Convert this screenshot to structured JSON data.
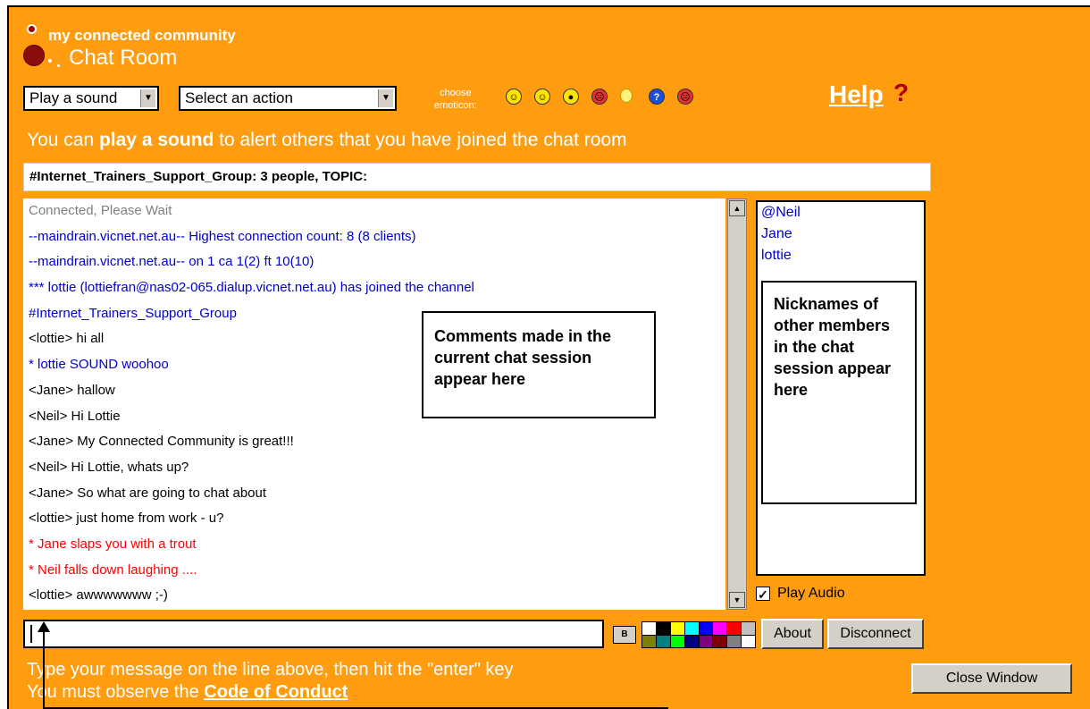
{
  "header": {
    "brand": "my connected community",
    "title": "Chat Room"
  },
  "controls": {
    "sound_select": "Play a sound",
    "action_select": "Select an action",
    "emoticon_label_1": "choose",
    "emoticon_label_2": "emoticon:",
    "emoticons": [
      "smile-icon",
      "happy-icon",
      "cool-icon",
      "angry-icon",
      "lightbulb-icon",
      "question-icon",
      "frown-icon"
    ],
    "help": "Help",
    "help_mark": "?"
  },
  "hint": {
    "pre": "You can ",
    "bold": "play a sound",
    "post": " to alert others that you have joined the chat room"
  },
  "topic": "#Internet_Trainers_Support_Group: 3 people, TOPIC:",
  "chat": {
    "lines": [
      {
        "text": "Connected, Please Wait",
        "color": "#808080"
      },
      {
        "text": "--maindrain.vicnet.net.au-- Highest connection count: 8 (8 clients)",
        "color": "#0000cc"
      },
      {
        "text": "--maindrain.vicnet.net.au-- on 1 ca 1(2) ft 10(10)",
        "color": "#0000cc"
      },
      {
        "text": "*** lottie (lottiefran@nas02-065.dialup.vicnet.net.au) has joined the channel",
        "color": "#0000cc"
      },
      {
        "text": "  #Internet_Trainers_Support_Group",
        "color": "#0000cc"
      },
      {
        "text": "<lottie> hi all",
        "color": "#000000"
      },
      {
        "text": "* lottie SOUND woohoo",
        "color": "#0000cc"
      },
      {
        "text": "<Jane> hallow",
        "color": "#000000"
      },
      {
        "text": "<Neil> Hi Lottie",
        "color": "#000000"
      },
      {
        "text": "<Jane> My Connected Community is great!!!",
        "color": "#000000"
      },
      {
        "text": "<Neil> Hi Lottie, whats up?",
        "color": "#000000"
      },
      {
        "text": "<Jane> So what are going to chat about",
        "color": "#000000"
      },
      {
        "text": "<lottie> just home from work - u?",
        "color": "#000000"
      },
      {
        "text": "* Jane slaps you with a trout",
        "color": "#ff0000"
      },
      {
        "text": "* Neil falls down laughing ....",
        "color": "#ff0000"
      },
      {
        "text": "<lottie> awwwwwww ;-)",
        "color": "#000000"
      }
    ]
  },
  "nicks": [
    "@Neil",
    "Jane",
    "lottie"
  ],
  "callouts": {
    "chat": "Comments made in the current chat session appear here",
    "nicks": "Nicknames of other members in the chat session appear here"
  },
  "audio": {
    "label": "Play Audio",
    "checked": true
  },
  "input": {
    "value": "",
    "bold_label": "B"
  },
  "palette": [
    "#ffffff",
    "#000000",
    "#ffff00",
    "#00ffff",
    "#0000ff",
    "#ff00ff",
    "#ff0000",
    "#c0c0c0",
    "#808000",
    "#008080",
    "#00ff00",
    "#000080",
    "#800080",
    "#800000",
    "#808080",
    "#ffffff"
  ],
  "buttons": {
    "about": "About",
    "disconnect": "Disconnect",
    "close": "Close Window"
  },
  "footer": {
    "line1": "Type your message on the line above, then hit the \"enter\" key",
    "line2_pre": "You must observe the ",
    "line2_link": "Code of Conduct"
  }
}
